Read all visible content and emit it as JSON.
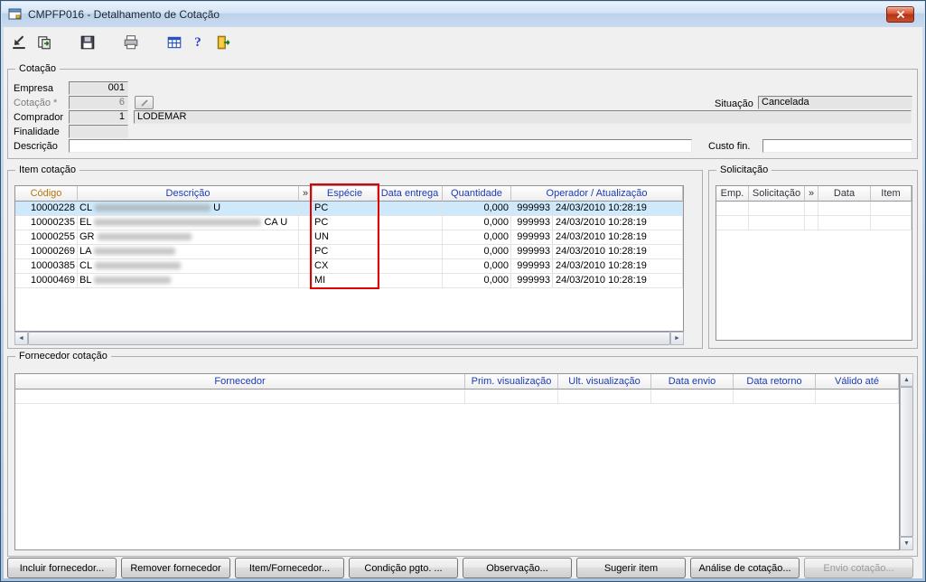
{
  "window": {
    "title": "CMPFP016 - Detalhamento de Cotação"
  },
  "toolbar": {
    "icons": [
      "implant-icon",
      "copy-record-icon",
      "save-icon",
      "print-icon",
      "grid-icon",
      "help-icon",
      "exit-icon"
    ]
  },
  "cotacao": {
    "legend": "Cotação",
    "empresa_label": "Empresa",
    "empresa_value": "001",
    "cotacao_label": "Cotação *",
    "cotacao_value": "6",
    "comprador_label": "Comprador",
    "comprador_value": "1",
    "comprador_nome": "LODEMAR",
    "finalidade_label": "Finalidade",
    "finalidade_value": "",
    "descricao_label": "Descrição",
    "descricao_value": "",
    "situacao_label": "Situação",
    "situacao_value": "Cancelada",
    "custo_label": "Custo fin.",
    "custo_value": ""
  },
  "itens": {
    "legend": "Item cotação",
    "columns": {
      "codigo": "Código",
      "descricao": "Descrição",
      "chevron": "»",
      "especie": "Espécie",
      "entrega": "Data entrega",
      "quantidade": "Quantidade",
      "operador": "Operador / Atualização"
    },
    "rows": [
      {
        "codigo": "10000228",
        "desc_prefix": "CL",
        "desc_suffix": "U",
        "especie": "PC",
        "entrega": "",
        "quantidade": "0,000",
        "operador": "999993",
        "atualizacao": "24/03/2010 10:28:19"
      },
      {
        "codigo": "10000235",
        "desc_prefix": "EL",
        "desc_suffix": "CA U",
        "especie": "PC",
        "entrega": "",
        "quantidade": "0,000",
        "operador": "999993",
        "atualizacao": "24/03/2010 10:28:19"
      },
      {
        "codigo": "10000255",
        "desc_prefix": "GR",
        "desc_suffix": "",
        "especie": "UN",
        "entrega": "",
        "quantidade": "0,000",
        "operador": "999993",
        "atualizacao": "24/03/2010 10:28:19"
      },
      {
        "codigo": "10000269",
        "desc_prefix": "LA",
        "desc_suffix": "",
        "especie": "PC",
        "entrega": "",
        "quantidade": "0,000",
        "operador": "999993",
        "atualizacao": "24/03/2010 10:28:19"
      },
      {
        "codigo": "10000385",
        "desc_prefix": "CL",
        "desc_suffix": "",
        "especie": "CX",
        "entrega": "",
        "quantidade": "0,000",
        "operador": "999993",
        "atualizacao": "24/03/2010 10:28:19"
      },
      {
        "codigo": "10000469",
        "desc_prefix": "BL",
        "desc_suffix": "",
        "especie": "MI",
        "entrega": "",
        "quantidade": "0,000",
        "operador": "999993",
        "atualizacao": "24/03/2010 10:28:19"
      }
    ]
  },
  "annotation": {
    "target_column": "Espécie",
    "color": "#e10000"
  },
  "solicitacao": {
    "legend": "Solicitação",
    "columns": [
      "Emp.",
      "Solicitação",
      "»",
      "Data",
      "Item"
    ]
  },
  "fornecedor": {
    "legend": "Fornecedor cotação",
    "columns": [
      "Fornecedor",
      "Prim. visualização",
      "Ult. visualização",
      "Data envio",
      "Data retorno",
      "Válido até"
    ]
  },
  "footer": {
    "buttons": [
      {
        "label": "Incluir fornecedor...",
        "enabled": true
      },
      {
        "label": "Remover fornecedor",
        "enabled": true
      },
      {
        "label": "Item/Fornecedor...",
        "enabled": true
      },
      {
        "label": "Condição pgto. ...",
        "enabled": true
      },
      {
        "label": "Observação...",
        "enabled": true
      },
      {
        "label": "Sugerir item",
        "enabled": true
      },
      {
        "label": "Análise de cotação...",
        "enabled": true
      },
      {
        "label": "Envio cotação...",
        "enabled": false
      }
    ]
  }
}
